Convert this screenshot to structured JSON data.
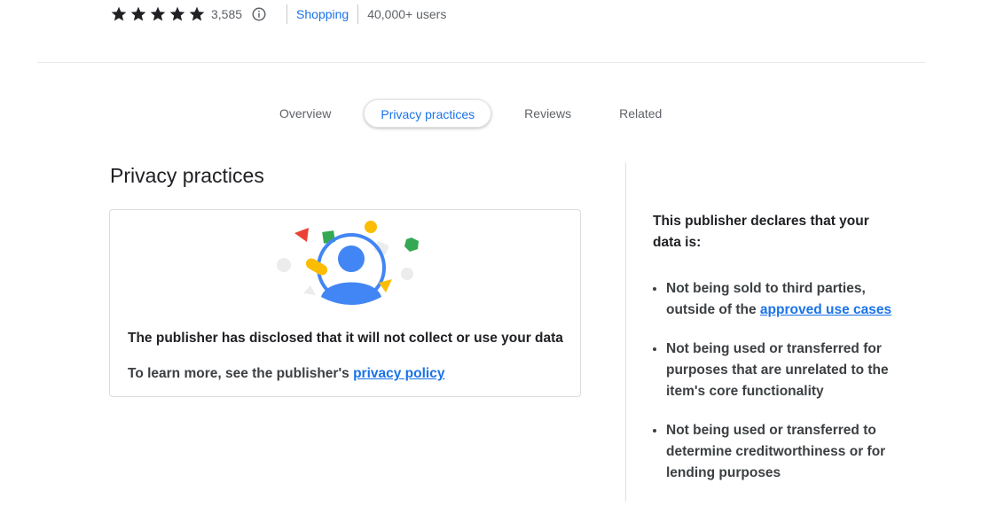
{
  "header": {
    "rating_stars": 5,
    "rating_count": "3,585",
    "category": "Shopping",
    "users": "40,000+ users"
  },
  "tabs": [
    {
      "label": "Overview",
      "active": false
    },
    {
      "label": "Privacy practices",
      "active": true
    },
    {
      "label": "Reviews",
      "active": false
    },
    {
      "label": "Related",
      "active": false
    }
  ],
  "privacy": {
    "title": "Privacy practices",
    "disclosure": "The publisher has disclosed that it will not collect or use your data",
    "learn_more_prefix": "To learn more, see the publisher's ",
    "policy_link": "privacy policy"
  },
  "declarations": {
    "heading": "This publisher declares that your data is:",
    "items": [
      {
        "text": "Not being sold to third parties, outside of the ",
        "link": "approved use cases"
      },
      {
        "text": "Not being used or transferred for purposes that are unrelated to the item's core functionality"
      },
      {
        "text": "Not being used or transferred to determine creditworthiness or for lending purposes"
      }
    ]
  },
  "colors": {
    "accent": "#1a73e8",
    "text": "#202124",
    "secondary": "#5f6368",
    "google_red": "#ea4335",
    "google_green": "#34a853",
    "google_yellow": "#fbbc04",
    "google_blue": "#4285f4"
  },
  "icons": [
    "star-icon",
    "info-icon",
    "privacy-illustration"
  ]
}
